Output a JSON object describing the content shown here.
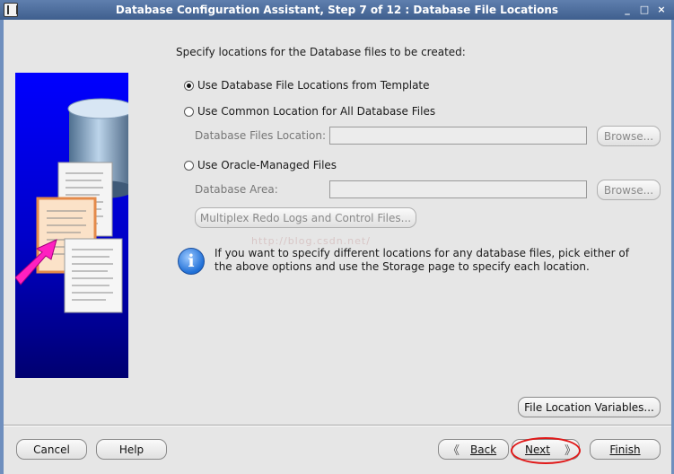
{
  "window": {
    "title": "Database Configuration Assistant, Step 7 of 12 : Database File Locations",
    "controls": [
      "_",
      "□",
      "×"
    ]
  },
  "heading": "Specify locations for the Database files to be created:",
  "options": {
    "template": "Use Database File Locations from Template",
    "common": "Use Common Location for All Database Files",
    "files_location_label": "Database Files Location:",
    "files_location_value": "",
    "omf": "Use Oracle-Managed Files",
    "area_label": "Database Area:",
    "area_value": "",
    "browse": "Browse...",
    "multiplex": "Multiplex Redo Logs and Control Files..."
  },
  "selected_option": "template",
  "info": {
    "icon": "info-icon",
    "text": "If you want to specify different locations for any database files, pick either of the above options and use the Storage page to specify each location."
  },
  "watermark": "http://blog.csdn.net/",
  "file_location_variables": "File Location Variables...",
  "footer": {
    "cancel": "Cancel",
    "help": "Help",
    "back": "Back",
    "next": "Next",
    "finish": "Finish"
  },
  "colors": {
    "title_bar": "#4f6f9e",
    "art_background": "#0000e0",
    "highlight_circle": "#e01818"
  }
}
